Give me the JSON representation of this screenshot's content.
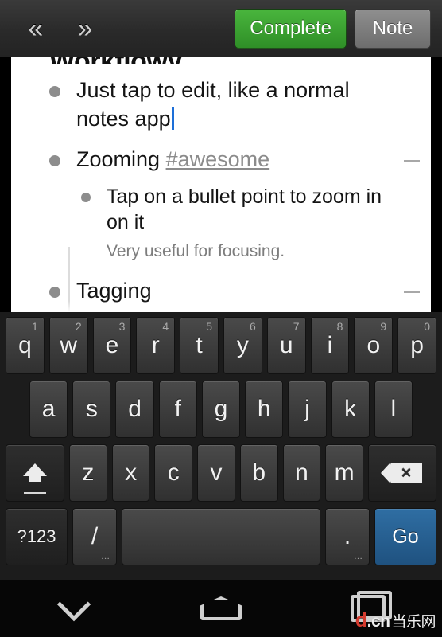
{
  "topbar": {
    "back_icon": "«",
    "forward_icon": "»",
    "complete_label": "Complete",
    "note_label": "Note"
  },
  "note": {
    "clipped_title": "Workflowy",
    "items": [
      {
        "level": 1,
        "text_before": "Just tap to edit, like a normal notes app",
        "has_caret": true
      },
      {
        "level": 1,
        "text_before": "Zooming ",
        "tag": "#awesome",
        "collapse_handle": "—"
      },
      {
        "level": 2,
        "text_before": "Tap on a bullet point to zoom in on it",
        "subnote": "Very useful for focusing."
      },
      {
        "level": 1,
        "text_before": "Tagging",
        "collapse_handle": "—"
      }
    ]
  },
  "keyboard": {
    "row1": [
      {
        "label": "q",
        "num": "1"
      },
      {
        "label": "w",
        "num": "2"
      },
      {
        "label": "e",
        "num": "3"
      },
      {
        "label": "r",
        "num": "4"
      },
      {
        "label": "t",
        "num": "5"
      },
      {
        "label": "y",
        "num": "6"
      },
      {
        "label": "u",
        "num": "7"
      },
      {
        "label": "i",
        "num": "8"
      },
      {
        "label": "o",
        "num": "9"
      },
      {
        "label": "p",
        "num": "0"
      }
    ],
    "row2": [
      {
        "label": "a"
      },
      {
        "label": "s"
      },
      {
        "label": "d"
      },
      {
        "label": "f"
      },
      {
        "label": "g"
      },
      {
        "label": "h"
      },
      {
        "label": "j"
      },
      {
        "label": "k"
      },
      {
        "label": "l"
      }
    ],
    "row3": [
      {
        "label": "z"
      },
      {
        "label": "x"
      },
      {
        "label": "c"
      },
      {
        "label": "v"
      },
      {
        "label": "b"
      },
      {
        "label": "n"
      },
      {
        "label": "m"
      }
    ],
    "shift_name": "shift-key",
    "backspace_name": "backspace-key",
    "row4": {
      "symbols_label": "?123",
      "slash_label": "/",
      "slash_sub": "...",
      "space_label": "",
      "period_label": ".",
      "period_sub": "...",
      "go_label": "Go"
    }
  },
  "navbar": {
    "back_icon": "chevron-down",
    "home_icon": "home",
    "recents_icon": "recents"
  },
  "watermark": {
    "d": "d",
    "cn": ".cn",
    "zh": "当乐网"
  },
  "colors": {
    "complete_green": "#3a9c30",
    "note_gray": "#7d7d7d",
    "go_blue": "#2a5f92",
    "caret_blue": "#1d6fd8",
    "tag_gray": "#8b8b8b",
    "watermark_red": "#d43b2f"
  }
}
